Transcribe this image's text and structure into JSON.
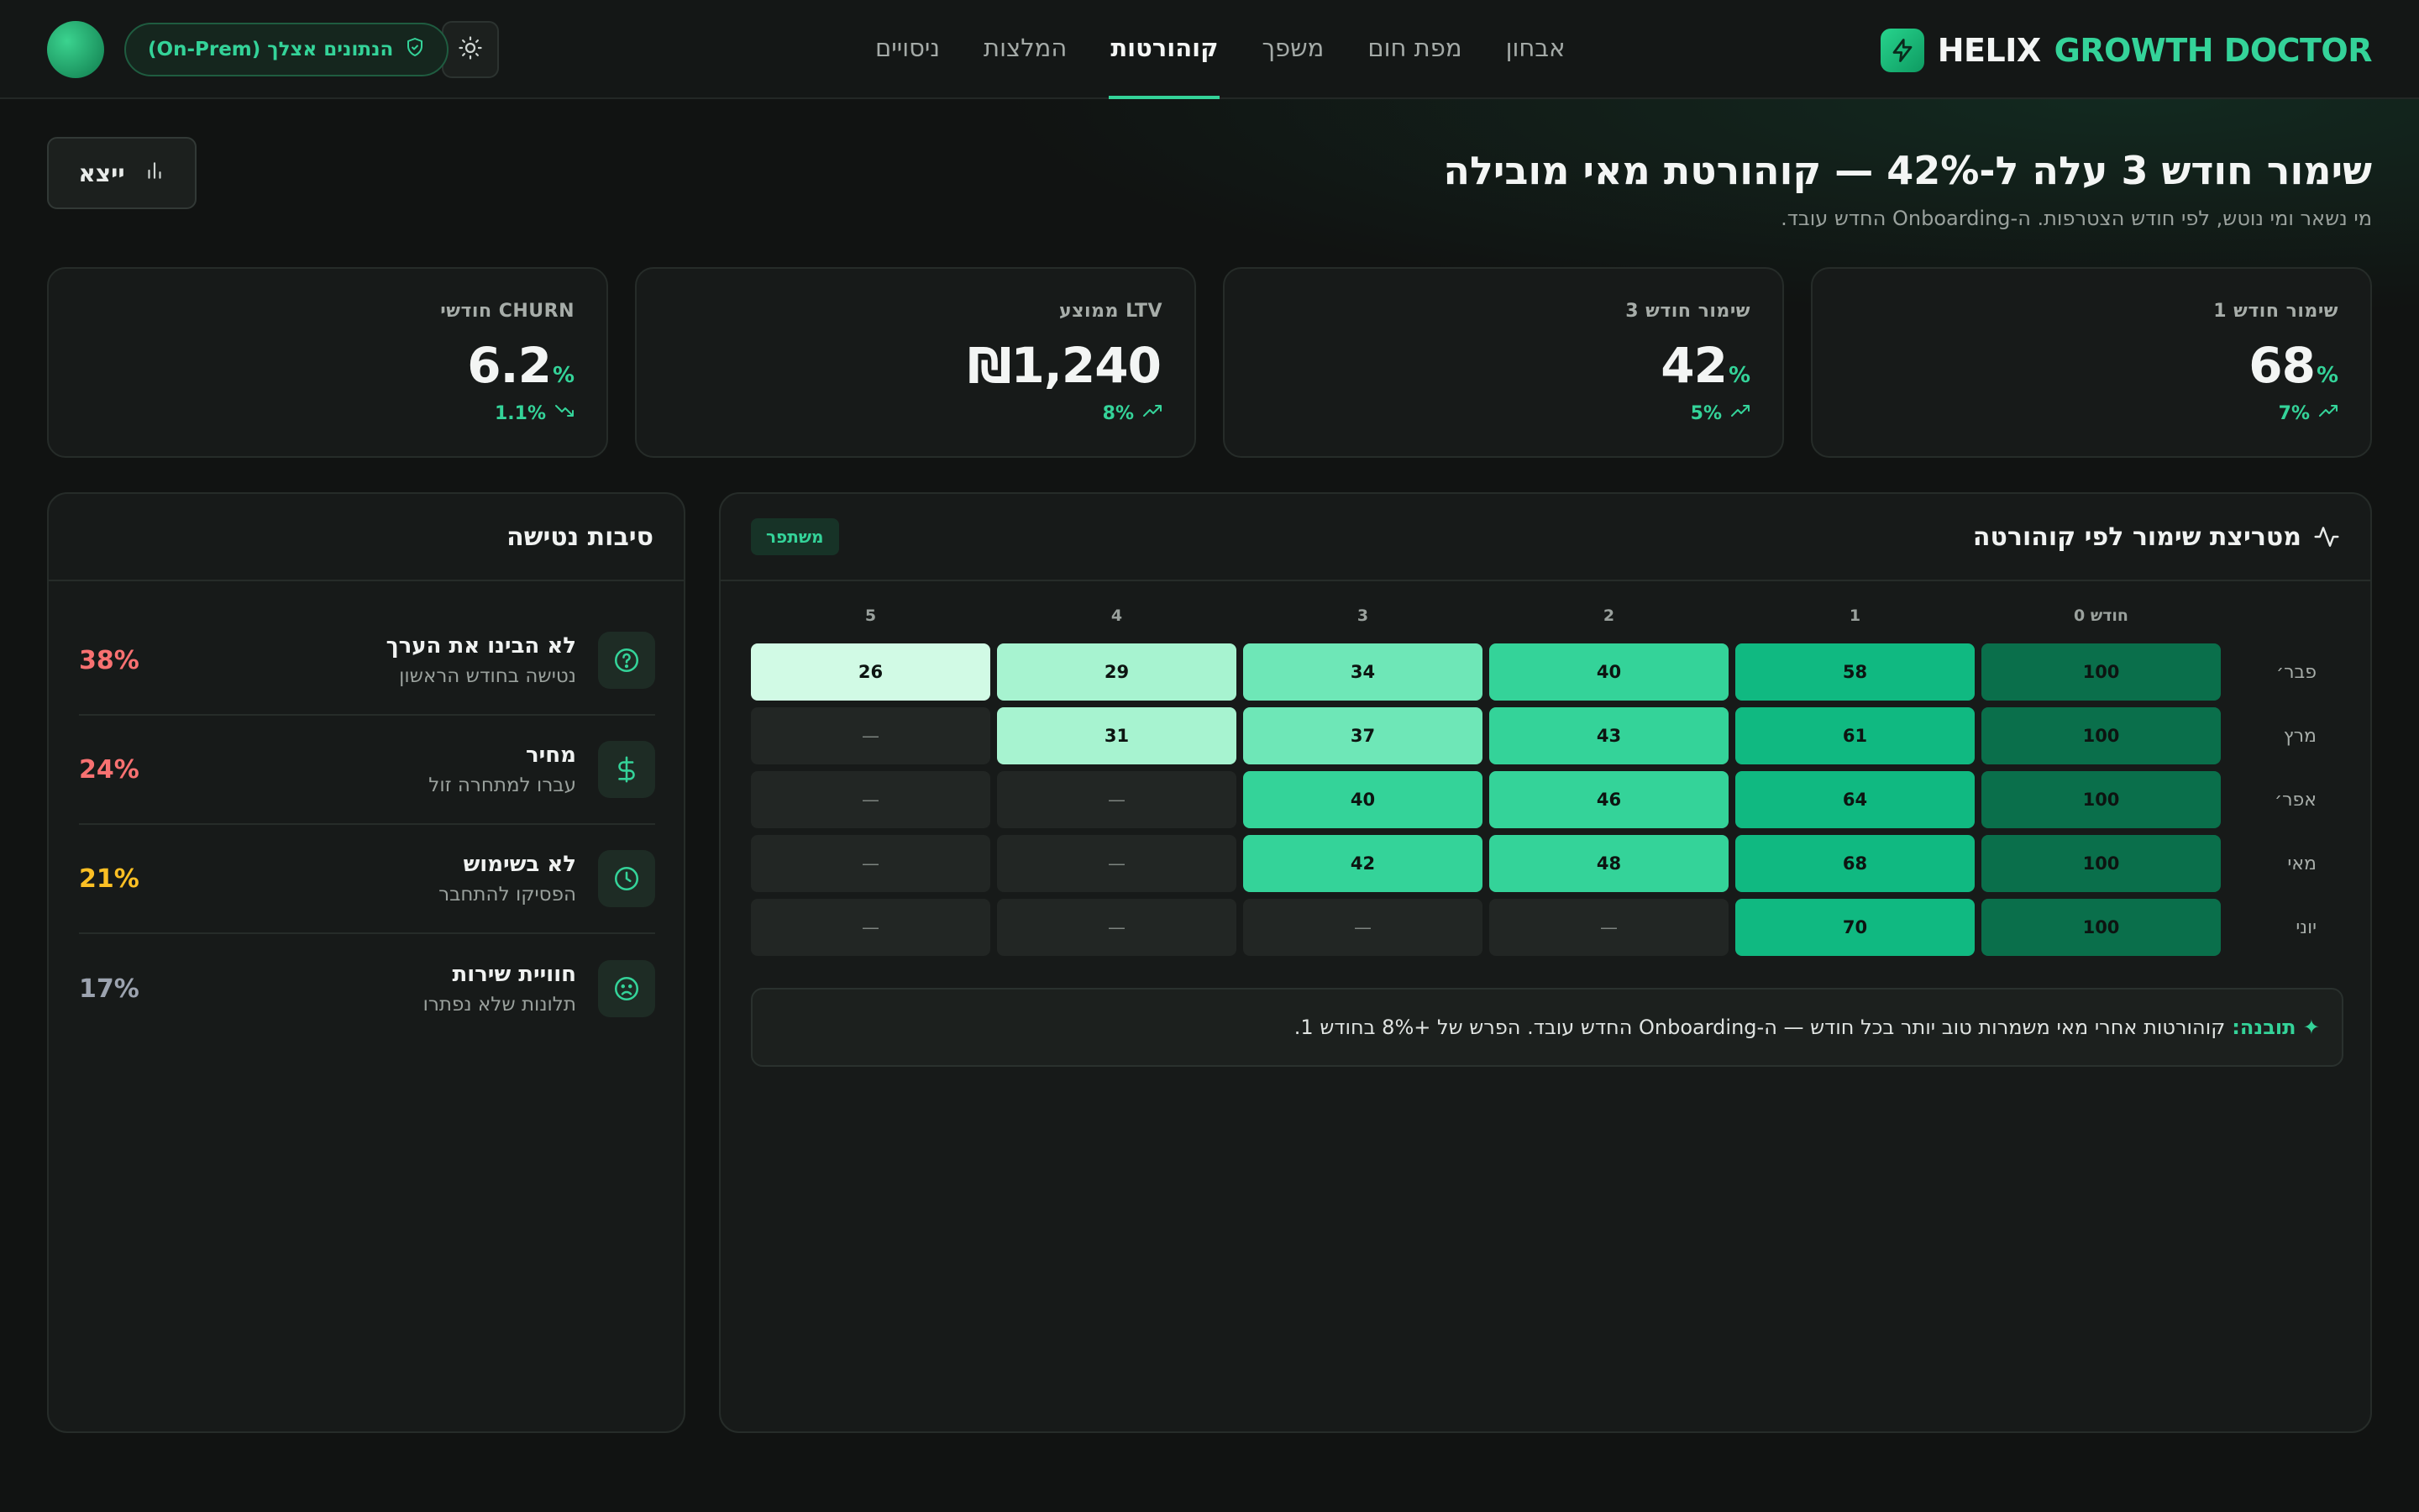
{
  "app": {
    "brand_primary": "HELIX",
    "brand_secondary": "GROWTH DOCTOR",
    "brand_icon": "lightning-bolt-icon",
    "accent": "#34d399"
  },
  "nav": {
    "tabs": [
      {
        "label": "אבחון",
        "active": false
      },
      {
        "label": "מפת חום",
        "active": false
      },
      {
        "label": "משפך",
        "active": false
      },
      {
        "label": "קוהורטות",
        "active": true
      },
      {
        "label": "המלצות",
        "active": false
      },
      {
        "label": "ניסויים",
        "active": false
      }
    ],
    "onprem_label": "הנתונים אצלך (On-Prem)",
    "onprem_icon": "shield-check-icon",
    "theme_icon": "sun-icon"
  },
  "header": {
    "title": "שימור חודש 3 עלה ל-42% — קוהורטת מאי מובילה",
    "subtitle": "מי נשאר ומי נוטש, לפי חודש הצטרפות. ה-Onboarding החדש עובד.",
    "export_label": "ייצא",
    "export_icon": "bar-chart-icon"
  },
  "kpis": [
    {
      "label": "שימור חודש 1",
      "value": "68",
      "unit": "%",
      "delta": "7%",
      "trend": "up"
    },
    {
      "label": "שימור חודש 3",
      "value": "42",
      "unit": "%",
      "delta": "5%",
      "trend": "up"
    },
    {
      "label": "LTV ממוצע",
      "value": "₪1,240",
      "unit": "",
      "delta": "8%",
      "trend": "up"
    },
    {
      "label": "CHURN חודשי",
      "value": "6.2",
      "unit": "%",
      "delta": "1.1%",
      "trend": "down"
    }
  ],
  "retention": {
    "title": "מטריצת שימור לפי קוהורטה",
    "title_icon": "activity-icon",
    "badge": "משתפר",
    "columns": [
      "חודש 0",
      "1",
      "2",
      "3",
      "4",
      "5"
    ],
    "rows": [
      {
        "label": "פבר׳",
        "values": [
          "100",
          "58",
          "40",
          "34",
          "29",
          "26"
        ]
      },
      {
        "label": "מרץ",
        "values": [
          "100",
          "61",
          "43",
          "37",
          "31",
          "—"
        ]
      },
      {
        "label": "אפר׳",
        "values": [
          "100",
          "64",
          "46",
          "40",
          "—",
          "—"
        ]
      },
      {
        "label": "מאי",
        "values": [
          "100",
          "68",
          "48",
          "42",
          "—",
          "—"
        ]
      },
      {
        "label": "יוני",
        "values": [
          "100",
          "70",
          "—",
          "—",
          "—",
          "—"
        ]
      }
    ],
    "insight_label": "✦ תובנה:",
    "insight_text": "קוהורטות אחרי מאי משמרות טוב יותר בכל חודש — ה-Onboarding החדש עובד. הפרש של +8% בחודש 1."
  },
  "churn": {
    "title": "סיבות נטישה",
    "reasons": [
      {
        "title": "לא הבינו את הערך",
        "sub": "נטישה בחודש הראשון",
        "pct": "38%",
        "color": "#f87171",
        "icon": "question-circle-icon"
      },
      {
        "title": "מחיר",
        "sub": "עברו למתחרה זול",
        "pct": "24%",
        "color": "#f87171",
        "icon": "dollar-icon"
      },
      {
        "title": "לא בשימוש",
        "sub": "הפסיקו להתחבר",
        "pct": "21%",
        "color": "#fbbf24",
        "icon": "clock-icon"
      },
      {
        "title": "חוויית שירות",
        "sub": "תלונות שלא נפתרו",
        "pct": "17%",
        "color": "#9ca3af",
        "icon": "frown-icon"
      }
    ]
  }
}
